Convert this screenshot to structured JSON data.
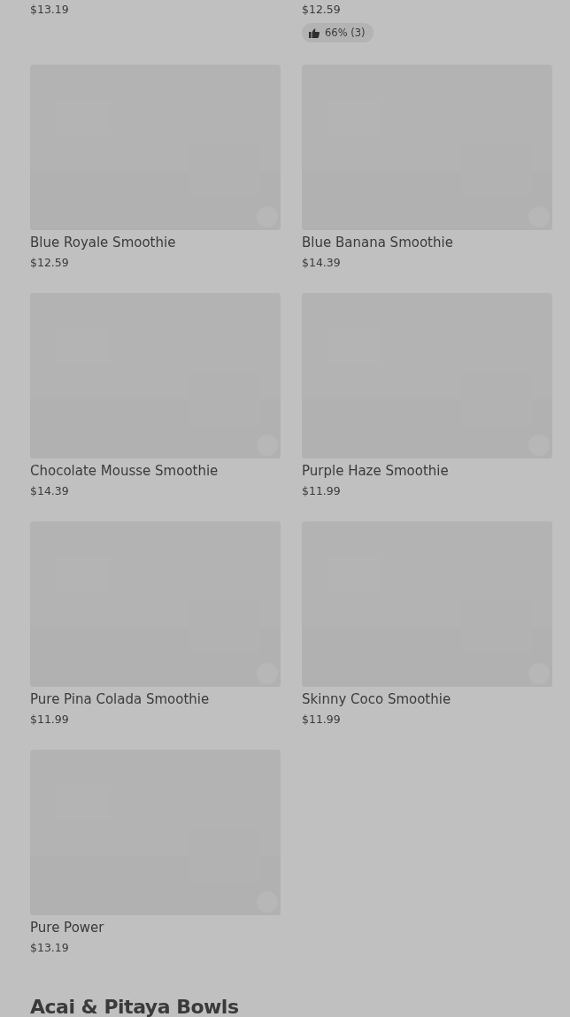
{
  "items": [
    {
      "price": "$13.19"
    },
    {
      "price": "$12.59",
      "rating": "66% (3)"
    },
    {
      "name": "Blue Royale Smoothie",
      "price": "$12.59"
    },
    {
      "name": "Blue Banana Smoothie",
      "price": "$14.39"
    },
    {
      "name": "Chocolate Mousse Smoothie",
      "price": "$14.39"
    },
    {
      "name": "Purple Haze Smoothie",
      "price": "$11.99"
    },
    {
      "name": "Pure Pina Colada Smoothie",
      "price": "$11.99"
    },
    {
      "name": "Skinny Coco Smoothie",
      "price": "$11.99"
    },
    {
      "name": "Pure Power",
      "price": "$13.19"
    }
  ],
  "next_section": {
    "title": "Acai & Pitaya Bowls"
  }
}
